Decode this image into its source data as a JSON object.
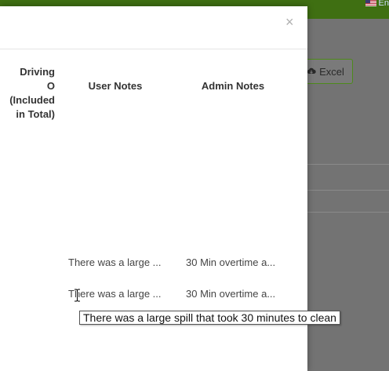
{
  "topbar": {
    "language": "En"
  },
  "background": {
    "export_button": {
      "label": "Excel",
      "icon": "cloud-download-icon"
    }
  },
  "modal": {
    "close_label": "×",
    "columns": {
      "driving": [
        "Driving",
        "O (Included",
        "in Total)"
      ],
      "user_notes": "User Notes",
      "admin_notes": "Admin Notes"
    },
    "rows": [
      {
        "user_notes": "There was a large ...",
        "admin_notes": "30 Min overtime a..."
      },
      {
        "user_notes": "There was a large ...",
        "admin_notes": "30 Min overtime a..."
      }
    ]
  },
  "tooltip": {
    "text": "There was a large spill that took 30 minutes to clean"
  },
  "colors": {
    "topbar": "#3f6f12",
    "accent": "#4d8a1b",
    "overlay": "#6f6f6f"
  }
}
